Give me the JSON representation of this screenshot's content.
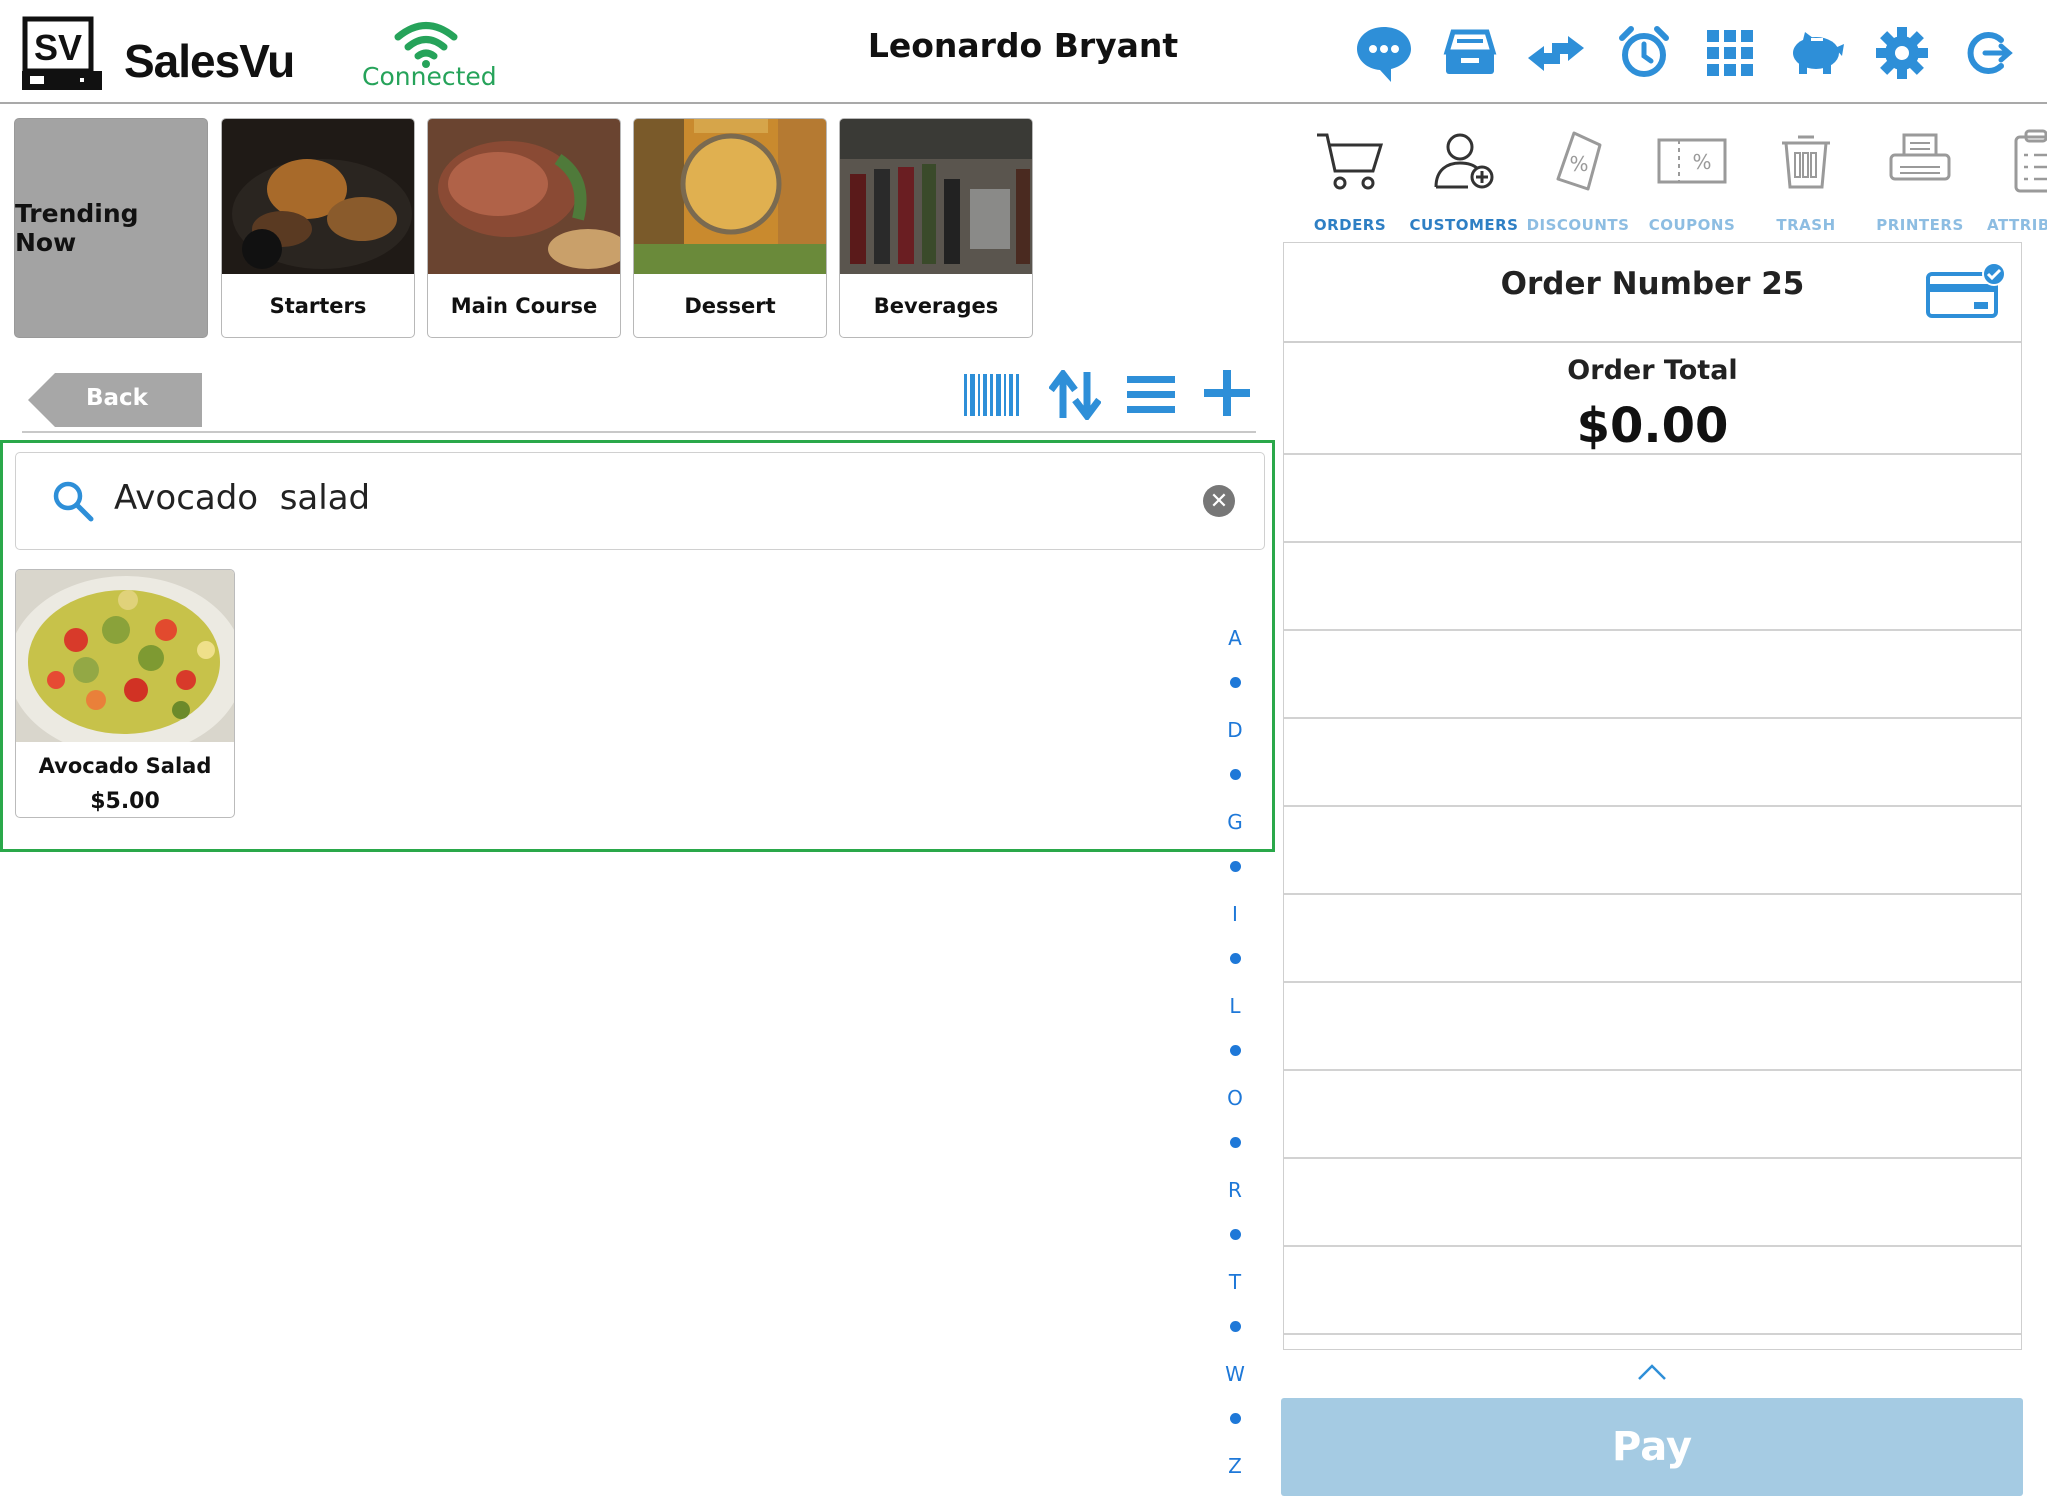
{
  "header": {
    "brand": "SalesVu",
    "logo_text": "SV",
    "connection_status": "Connected",
    "user_name": "Leonardo Bryant",
    "icons": [
      "chat-icon",
      "cash-drawer-icon",
      "transfer-icon",
      "alarm-clock-icon",
      "grid-icon",
      "piggy-bank-icon",
      "gear-icon",
      "logout-icon"
    ]
  },
  "categories": [
    {
      "label": "Trending Now"
    },
    {
      "label": "Starters"
    },
    {
      "label": "Main Course"
    },
    {
      "label": "Dessert"
    },
    {
      "label": "Beverages"
    }
  ],
  "nav": {
    "back_label": "Back"
  },
  "search": {
    "value": "Avocado  salad",
    "clear_symbol": "✕"
  },
  "results": [
    {
      "name": "Avocado Salad",
      "price": "$5.00"
    }
  ],
  "alpha_index": [
    "A",
    "D",
    "G",
    "I",
    "L",
    "O",
    "R",
    "T",
    "W",
    "Z"
  ],
  "toolbar": {
    "items": [
      {
        "label": "ORDERS",
        "color": "#2e7fc4"
      },
      {
        "label": "CUSTOMERS",
        "color": "#2e7fc4"
      },
      {
        "label": "DISCOUNTS",
        "color": "#8dbde2"
      },
      {
        "label": "COUPONS",
        "color": "#8dbde2"
      },
      {
        "label": "TRASH",
        "color": "#8dbde2"
      },
      {
        "label": "PRINTERS",
        "color": "#8dbde2"
      },
      {
        "label": "ATTRIBU",
        "color": "#8dbde2"
      }
    ]
  },
  "order": {
    "number_label": "Order Number 25",
    "total_label": "Order Total",
    "total_value": "$0.00"
  },
  "pay": {
    "label": "Pay"
  },
  "colors": {
    "accent": "#2e8fd8",
    "connected": "#26a35a",
    "panel_border": "#2aa84a",
    "pay_button": "#a5cbe3",
    "category_selected": "#a3a3a3"
  }
}
